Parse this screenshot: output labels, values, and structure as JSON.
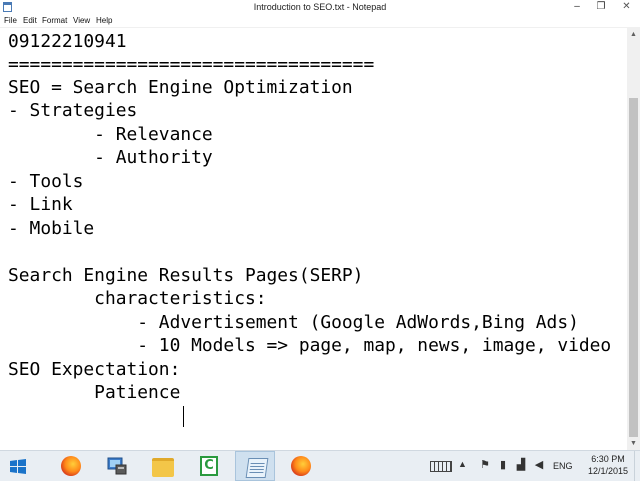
{
  "window": {
    "title": "Introduction to SEO.txt - Notepad",
    "minimize_glyph": "–",
    "maximize_glyph": "❐",
    "close_glyph": "✕"
  },
  "menu": [
    "File",
    "Edit",
    "Format",
    "View",
    "Help"
  ],
  "editor": {
    "lines": [
      "09122210941",
      "==================================",
      "SEO = Search Engine Optimization",
      "- Strategies",
      "        - Relevance",
      "        - Authority",
      "- Tools",
      "- Link",
      "- Mobile",
      "",
      "Search Engine Results Pages(SERP)",
      "        characteristics:",
      "            - Advertisement (Google AdWords,Bing Ads)",
      "            - 10 Models => page, map, news, image, video",
      "SEO Expectation:",
      "        Patience"
    ]
  },
  "scrollbar": {
    "up_glyph": "▲",
    "down_glyph": "▼"
  },
  "taskbar": {
    "items": [
      {
        "name": "start-button",
        "icon": "windows-logo-icon"
      },
      {
        "name": "firefox",
        "icon": "firefox-icon"
      },
      {
        "name": "control-panel",
        "icon": "system-icon"
      },
      {
        "name": "file-explorer",
        "icon": "folder-icon"
      },
      {
        "name": "camtasia",
        "icon": "camtasia-icon",
        "glyph": "C"
      },
      {
        "name": "notepad",
        "icon": "notepad-icon",
        "active": true
      },
      {
        "name": "firefox-2",
        "icon": "firefox-icon"
      }
    ],
    "tray": {
      "language": "ENG",
      "time": "6:30 PM",
      "date": "12/1/2015"
    }
  },
  "colors": {
    "taskbar_bg": "#e9eef3",
    "active_task": "#cfe0ef",
    "scroll_thumb": "#c2c2c2",
    "camtasia_green": "#2b9a3f"
  }
}
